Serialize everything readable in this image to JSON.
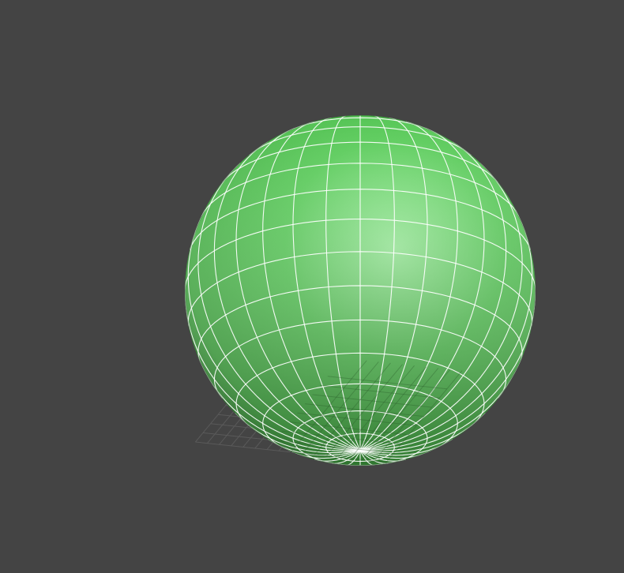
{
  "viewport": {
    "background": "#444444",
    "view": "perspective",
    "shading": "default-shading-with-edged-faces"
  },
  "home_grid": {
    "visible": true,
    "line_color": "#5a5a5a",
    "axis_color": "#1a1a1a",
    "divisions": 16
  },
  "object": {
    "type": "sphere",
    "color": "#5ccc5c",
    "highlight_color": "#a3f0a3",
    "shadow_color": "#2f7a2f",
    "wireframe_color": "#ffffff",
    "selected": true,
    "segments": 32
  }
}
